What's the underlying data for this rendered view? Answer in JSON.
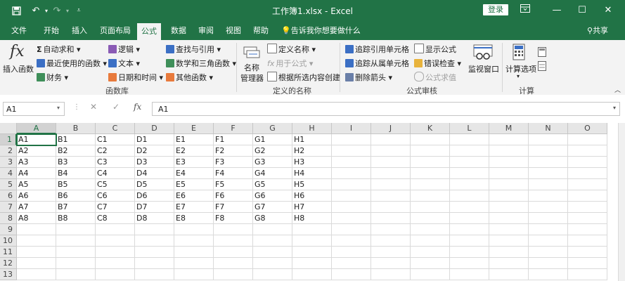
{
  "window": {
    "title": "工作簿1.xlsx  -  Excel",
    "login_label": "登录",
    "controls": [
      "ribbon-display-icon",
      "minimize-icon",
      "maximize-icon",
      "close-icon"
    ]
  },
  "quick_access": [
    "save-icon",
    "undo-icon",
    "redo-icon",
    "customize-icon"
  ],
  "tabs": [
    "文件",
    "开始",
    "插入",
    "页面布局",
    "公式",
    "数据",
    "审阅",
    "视图",
    "帮助"
  ],
  "active_tab": "公式",
  "tell_me": "告诉我你想要做什么",
  "share_label": "共享",
  "ribbon": {
    "insert_function": "插入函数",
    "autosum": "自动求和",
    "recent": "最近使用的函数",
    "financial": "财务",
    "logical": "逻辑",
    "text": "文本",
    "datetime": "日期和时间",
    "lookup": "查找与引用",
    "math": "数学和三角函数",
    "more": "其他函数",
    "group_library": "函数库",
    "name_manager_line1": "名称",
    "name_manager_line2": "管理器",
    "define_name": "定义名称",
    "use_in_formula": "用于公式",
    "create_from_selection": "根据所选内容创建",
    "group_defined_names": "定义的名称",
    "trace_precedents": "追踪引用单元格",
    "trace_dependents": "追踪从属单元格",
    "remove_arrows": "删除箭头",
    "show_formulas": "显示公式",
    "error_checking": "错误检查",
    "evaluate_formula": "公式求值",
    "watch_window": "监视窗口",
    "group_auditing": "公式审核",
    "calc_options": "计算选项",
    "group_calc": "计算"
  },
  "formula_bar": {
    "name_box": "A1",
    "formula": "A1"
  },
  "sheet": {
    "columns": [
      "A",
      "B",
      "C",
      "D",
      "E",
      "F",
      "G",
      "H",
      "I",
      "J",
      "K",
      "L",
      "M",
      "N",
      "O"
    ],
    "rows": [
      "1",
      "2",
      "3",
      "4",
      "5",
      "6",
      "7",
      "8",
      "9",
      "10",
      "11",
      "12",
      "13"
    ],
    "cells": [
      [
        "A1",
        "B1",
        "C1",
        "D1",
        "E1",
        "F1",
        "G1",
        "H1"
      ],
      [
        "A2",
        "B2",
        "C2",
        "D2",
        "E2",
        "F2",
        "G2",
        "H2"
      ],
      [
        "A3",
        "B3",
        "C3",
        "D3",
        "E3",
        "F3",
        "G3",
        "H3"
      ],
      [
        "A4",
        "B4",
        "C4",
        "D4",
        "E4",
        "F4",
        "G4",
        "H4"
      ],
      [
        "A5",
        "B5",
        "C5",
        "D5",
        "E5",
        "F5",
        "G5",
        "H5"
      ],
      [
        "A6",
        "B6",
        "C6",
        "D6",
        "E6",
        "F6",
        "G6",
        "H6"
      ],
      [
        "A7",
        "B7",
        "C7",
        "D7",
        "E7",
        "F7",
        "G7",
        "H7"
      ],
      [
        "A8",
        "B8",
        "C8",
        "D8",
        "E8",
        "F8",
        "G8",
        "H8"
      ]
    ],
    "active_cell": "A1"
  },
  "colors": {
    "accent": "#217346"
  }
}
